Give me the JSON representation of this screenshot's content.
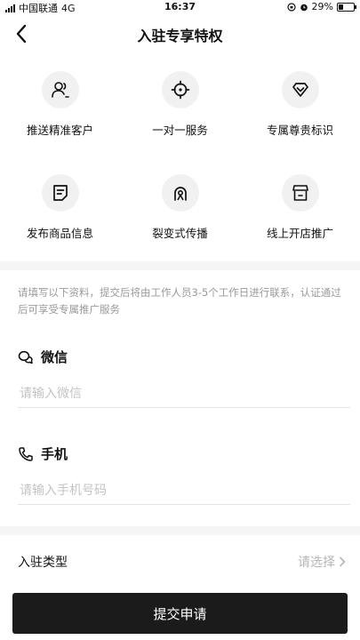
{
  "status_bar": {
    "carrier": "中国联通",
    "network": "4G",
    "time": "16:37",
    "battery": "29%"
  },
  "nav": {
    "title": "入驻专享特权",
    "back_icon": "chevron-left-icon"
  },
  "privileges": [
    {
      "label": "推送精准客户",
      "icon": "users-icon"
    },
    {
      "label": "一对一服务",
      "icon": "target-icon"
    },
    {
      "label": "专属尊贵标识",
      "icon": "diamond-badge-icon"
    },
    {
      "label": "发布商品信息",
      "icon": "document-icon"
    },
    {
      "label": "裂变式传播",
      "icon": "broadcast-icon"
    },
    {
      "label": "线上开店推广",
      "icon": "store-icon"
    }
  ],
  "form": {
    "notice": "请填写以下资料，提交后将由工作人员3-5个工作日进行联系，认证通过后可享受专属推广服务",
    "wechat": {
      "label": "微信",
      "placeholder": "请输入微信",
      "value": ""
    },
    "phone": {
      "label": "手机",
      "placeholder": "请输入手机号码",
      "value": ""
    },
    "type": {
      "label": "入驻类型",
      "placeholder": "请选择"
    }
  },
  "submit_label": "提交申请",
  "colors": {
    "primary": "#1b1b1b",
    "band": "#f5f5f5",
    "hint": "#9a9a9a",
    "placeholder": "#c4c4c4"
  }
}
